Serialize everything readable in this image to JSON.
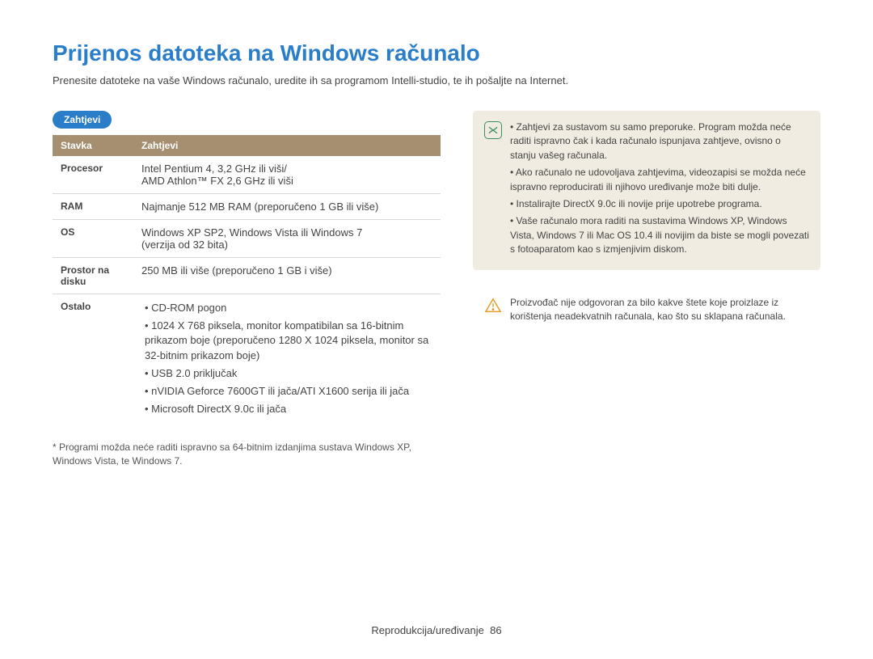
{
  "title": "Prijenos datoteka na Windows računalo",
  "intro": "Prenesite datoteke na vaše Windows računalo, uredite ih sa programom Intelli-studio, te ih pošaljte na Internet.",
  "sectionHeading": "Zahtjevi",
  "table": {
    "headers": {
      "col1": "Stavka",
      "col2": "Zahtjevi"
    },
    "rows": [
      {
        "label": "Procesor",
        "text": "Intel Pentium 4, 3,2 GHz ili viši/\nAMD Athlon™ FX 2,6 GHz ili viši"
      },
      {
        "label": "RAM",
        "text": "Najmanje 512 MB RAM (preporučeno 1 GB ili više)"
      },
      {
        "label": "OS",
        "text": "Windows XP SP2, Windows Vista ili Windows 7\n(verzija od 32 bita)"
      },
      {
        "label": "Prostor na disku",
        "text": "250 MB ili više (preporučeno 1 GB i više)"
      },
      {
        "label": "Ostalo",
        "list": [
          "CD-ROM pogon",
          "1024 X 768 piksela, monitor kompatibilan sa 16-bitnim prikazom boje (preporučeno 1280 X 1024 piksela, monitor sa 32-bitnim prikazom boje)",
          "USB 2.0 priključak",
          "nVIDIA Geforce 7600GT ili jača/ATI X1600 serija ili jača",
          "Microsoft DirectX 9.0c ili jača"
        ]
      }
    ]
  },
  "footnote": "* Programi možda neće raditi ispravno sa 64-bitnim izdanjima sustava Windows XP, Windows Vista, te Windows 7.",
  "infoNotes": [
    "Zahtjevi za sustavom  su samo preporuke. Program možda neće raditi ispravno čak i kada računalo ispunjava zahtjeve, ovisno o stanju vašeg računala.",
    "Ako računalo ne udovoljava zahtjevima, videozapisi se možda neće ispravno reproducirati ili njihovo uređivanje može biti dulje.",
    "Instalirajte DirectX 9.0c ili novije prije upotrebe programa.",
    "Vaše računalo mora raditi na sustavima Windows XP, Windows Vista, Windows 7 ili Mac OS 10.4 ili novijim da biste se mogli povezati s fotoaparatom kao s izmjenjivim diskom."
  ],
  "warnNote": "Proizvođač nije odgovoran za bilo kakve štete koje proizlaze iz korištenja neadekvatnih računala, kao što su sklapana računala.",
  "footer": {
    "section": "Reprodukcija/uređivanje",
    "page": "86"
  }
}
